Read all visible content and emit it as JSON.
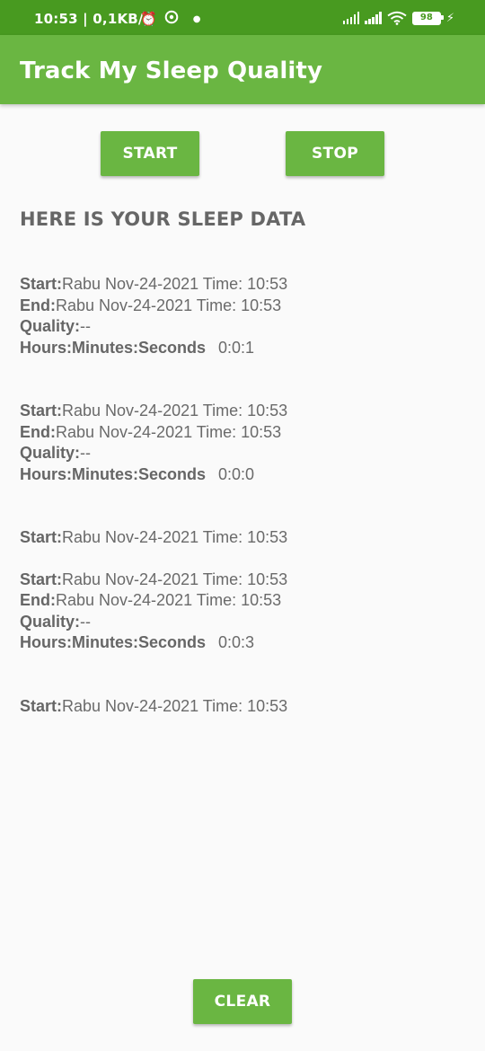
{
  "status_bar": {
    "time": "10:53",
    "speed": "0,1KB/d",
    "battery": "98",
    "icons": [
      "alarm-icon",
      "sync-icon",
      "dot-icon",
      "signal-icon",
      "signal-icon",
      "wifi-icon",
      "battery-icon",
      "charging-icon"
    ]
  },
  "app": {
    "title": "Track My Sleep Quality",
    "accent": "#6ab642",
    "status_color": "#489a20"
  },
  "buttons": {
    "start": "START",
    "stop": "STOP",
    "clear": "CLEAR"
  },
  "heading": "HERE IS YOUR SLEEP DATA",
  "labels": {
    "start": "Start:",
    "end": "End:",
    "quality": "Quality:",
    "hms": "Hours:Minutes:Seconds"
  },
  "records": [
    {
      "start": "Rabu Nov-24-2021 Time: 10:53",
      "end": "Rabu Nov-24-2021 Time: 10:53",
      "quality": "--",
      "duration": "0:0:1"
    },
    {
      "start": "Rabu Nov-24-2021 Time: 10:53",
      "end": "Rabu Nov-24-2021 Time: 10:53",
      "quality": "--",
      "duration": "0:0:0"
    },
    {
      "start": "Rabu Nov-24-2021 Time: 10:53"
    },
    {
      "start": "Rabu Nov-24-2021 Time: 10:53",
      "end": "Rabu Nov-24-2021 Time: 10:53",
      "quality": "--",
      "duration": "0:0:3"
    },
    {
      "start": "Rabu Nov-24-2021 Time: 10:53"
    }
  ]
}
